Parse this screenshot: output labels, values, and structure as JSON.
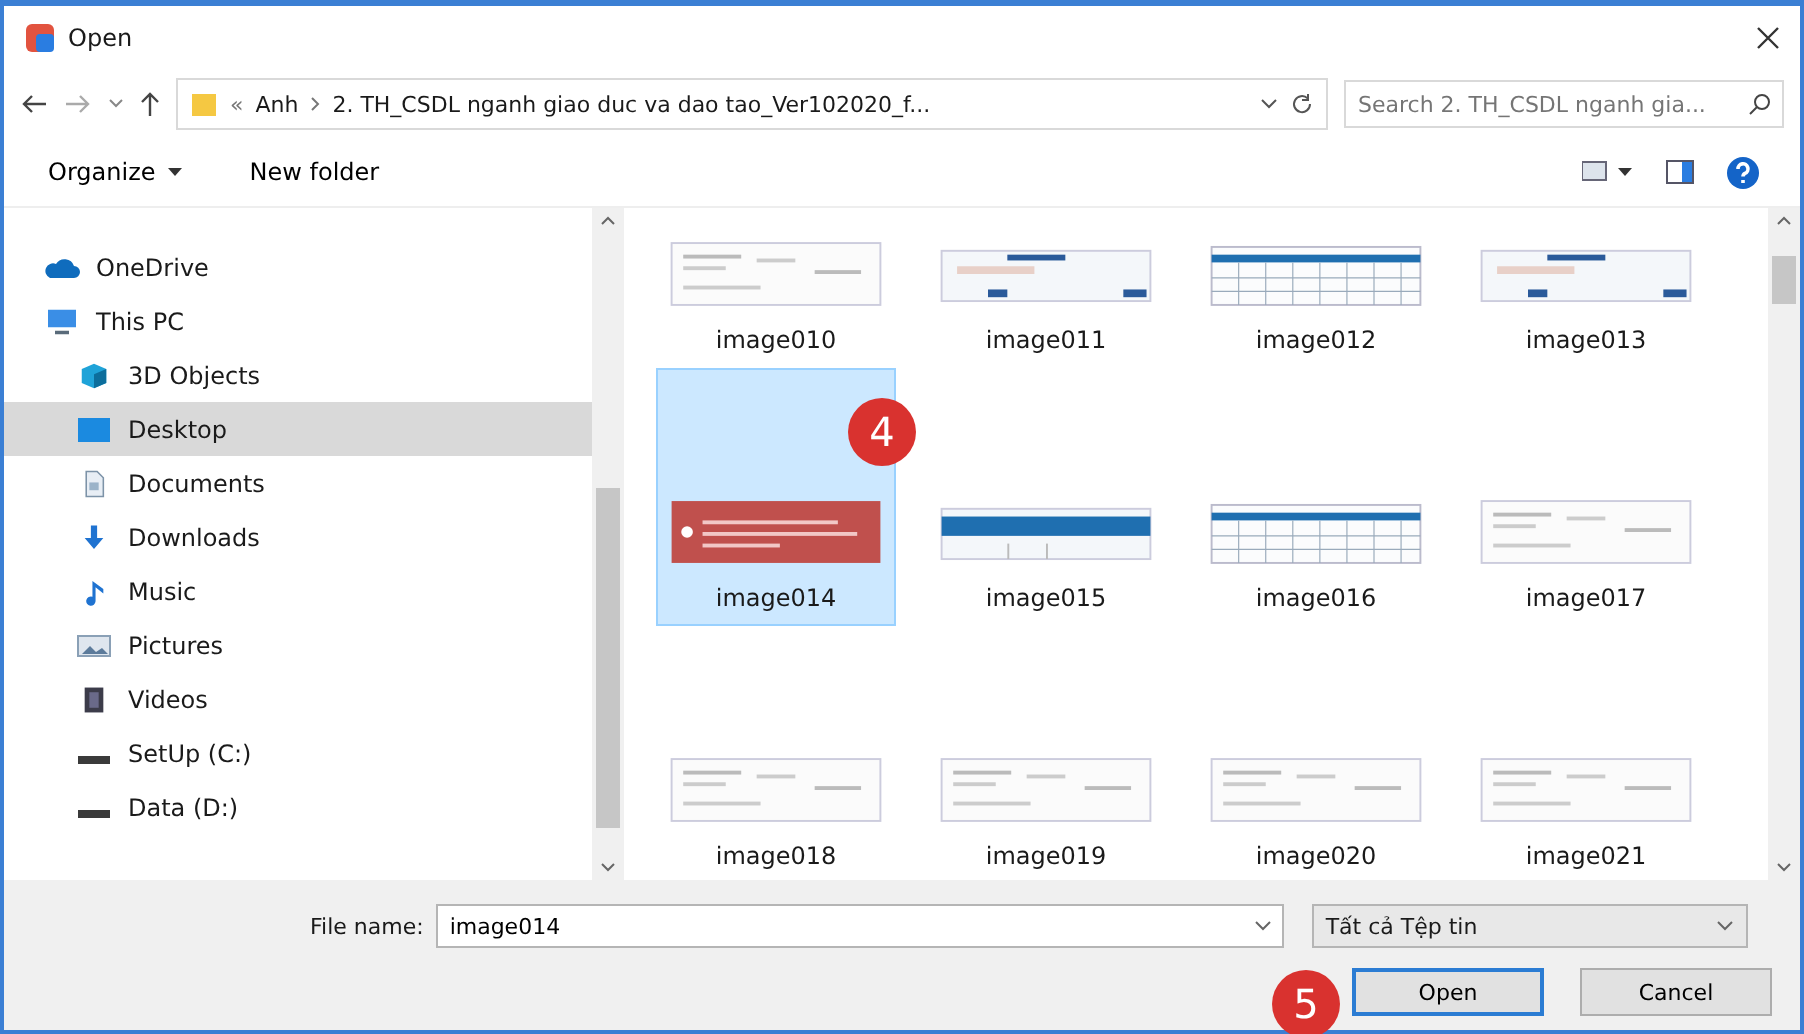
{
  "window": {
    "title": "Open"
  },
  "address": {
    "overflow": "«",
    "path": [
      {
        "label": "Anh"
      },
      {
        "label": "2. TH_CSDL nganh giao duc va dao tao_Ver102020_f..."
      }
    ]
  },
  "search": {
    "placeholder": "Search 2. TH_CSDL nganh gia..."
  },
  "toolbar": {
    "organize": "Organize",
    "new_folder": "New folder"
  },
  "sidebar": {
    "items": [
      {
        "label": "OneDrive",
        "selected": false
      },
      {
        "label": "This PC",
        "selected": false,
        "children": [
          {
            "label": "3D Objects",
            "selected": false
          },
          {
            "label": "Desktop",
            "selected": true
          },
          {
            "label": "Documents",
            "selected": false
          },
          {
            "label": "Downloads",
            "selected": false
          },
          {
            "label": "Music",
            "selected": false
          },
          {
            "label": "Pictures",
            "selected": false
          },
          {
            "label": "Videos",
            "selected": false
          },
          {
            "label": "SetUp (C:)",
            "selected": false
          },
          {
            "label": "Data (D:)",
            "selected": false
          }
        ]
      }
    ]
  },
  "files": [
    {
      "name": "image010",
      "kind": "document",
      "selected": false
    },
    {
      "name": "image011",
      "kind": "banner",
      "selected": false
    },
    {
      "name": "image012",
      "kind": "table",
      "selected": false
    },
    {
      "name": "image013",
      "kind": "banner",
      "selected": false
    },
    {
      "name": "image014",
      "kind": "alert",
      "selected": true
    },
    {
      "name": "image015",
      "kind": "header",
      "selected": false
    },
    {
      "name": "image016",
      "kind": "table",
      "selected": false
    },
    {
      "name": "image017",
      "kind": "document",
      "selected": false
    },
    {
      "name": "image018",
      "kind": "document",
      "selected": false
    },
    {
      "name": "image019",
      "kind": "document",
      "selected": false
    },
    {
      "name": "image020",
      "kind": "document",
      "selected": false
    },
    {
      "name": "image021",
      "kind": "document",
      "selected": false
    }
  ],
  "footer": {
    "file_name_label": "File name:",
    "file_name": "image014",
    "file_type": "Tất cả Tệp tin",
    "open": "Open",
    "cancel": "Cancel"
  },
  "annotations": [
    {
      "label": "4"
    },
    {
      "label": "5"
    }
  ]
}
